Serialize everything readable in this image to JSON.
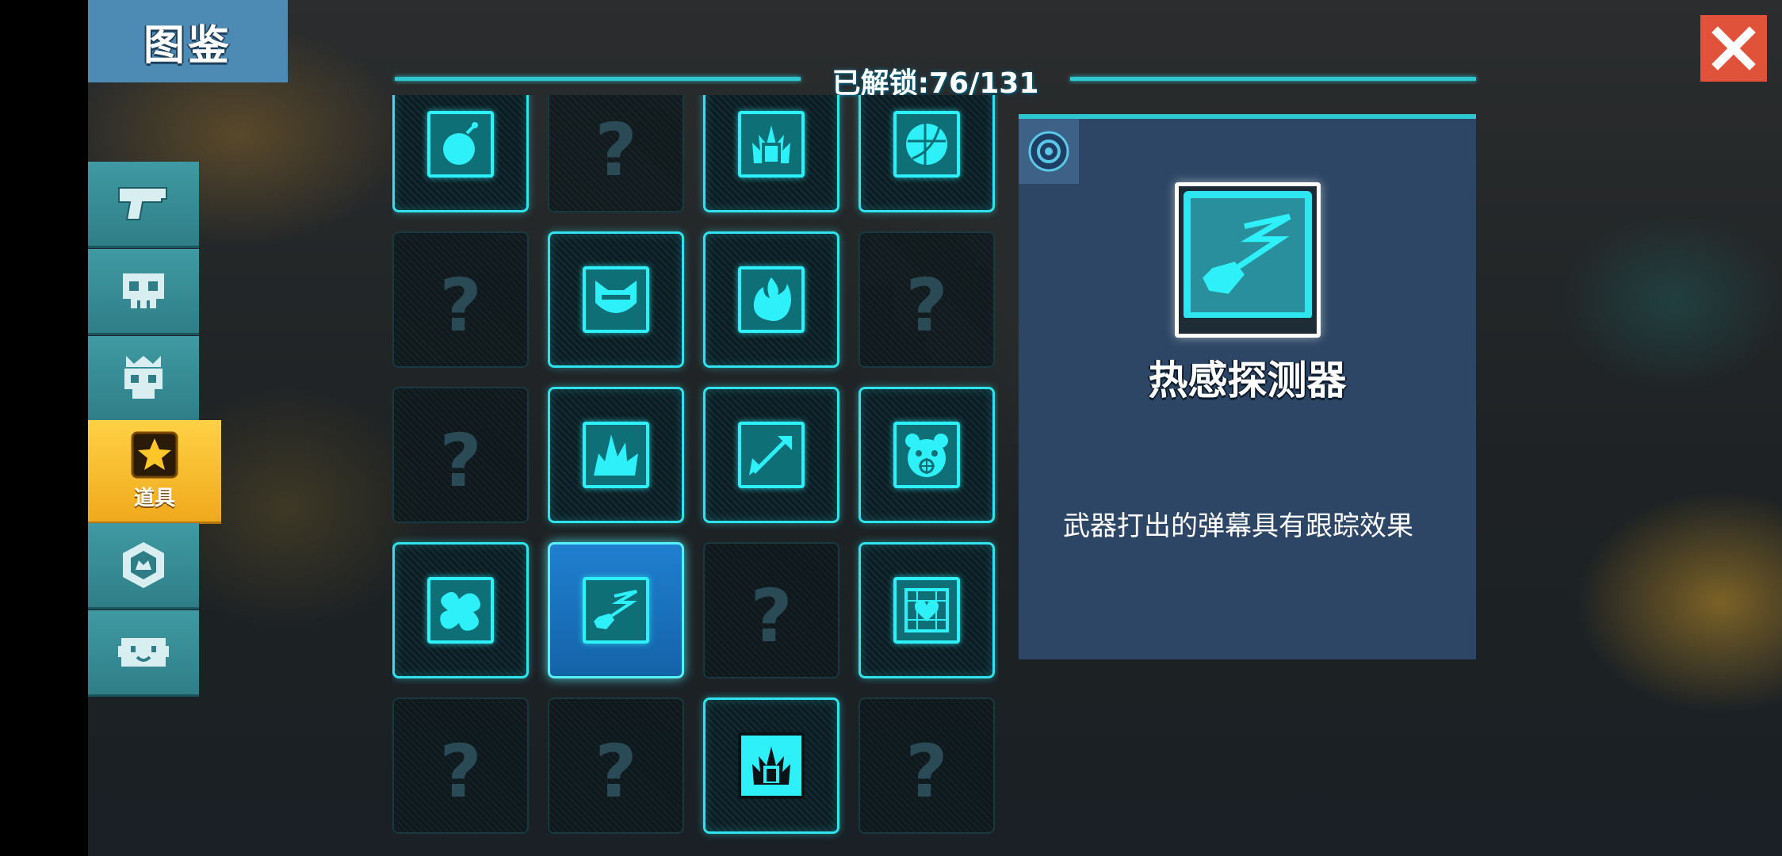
{
  "header": {
    "title": "图鉴",
    "unlock_text": "已解锁:76/131"
  },
  "close": {
    "icon": "close-icon"
  },
  "sidebar": {
    "tabs": [
      {
        "name": "weapons",
        "icon": "gun-icon",
        "label": ""
      },
      {
        "name": "monsters",
        "icon": "skull-icon",
        "label": ""
      },
      {
        "name": "bosses",
        "icon": "crowned-skull-icon",
        "label": ""
      },
      {
        "name": "items",
        "icon": "star-icon",
        "label": "道具",
        "active": true
      },
      {
        "name": "badges",
        "icon": "hexagon-badge-icon",
        "label": ""
      },
      {
        "name": "pets",
        "icon": "pet-face-icon",
        "label": ""
      }
    ]
  },
  "grid": {
    "cells": [
      {
        "state": "unlocked",
        "icon": "bomb-icon"
      },
      {
        "state": "locked",
        "text": "?"
      },
      {
        "state": "unlocked",
        "icon": "flame-jar-icon"
      },
      {
        "state": "unlocked",
        "icon": "orb-icon"
      },
      {
        "state": "locked",
        "text": "?"
      },
      {
        "state": "unlocked",
        "icon": "mask-icon"
      },
      {
        "state": "unlocked",
        "icon": "fire-icon"
      },
      {
        "state": "locked",
        "text": "?"
      },
      {
        "state": "locked",
        "text": "?"
      },
      {
        "state": "unlocked",
        "icon": "spike-burst-icon"
      },
      {
        "state": "unlocked",
        "icon": "diagonal-arrow-icon"
      },
      {
        "state": "unlocked",
        "icon": "bear-target-icon"
      },
      {
        "state": "unlocked",
        "icon": "splat-icon"
      },
      {
        "state": "selected",
        "icon": "heat-seeker-icon"
      },
      {
        "state": "locked",
        "text": "?"
      },
      {
        "state": "unlocked",
        "icon": "heart-frame-icon"
      },
      {
        "state": "locked",
        "text": "?"
      },
      {
        "state": "locked",
        "text": "?"
      },
      {
        "state": "unlocked-dark",
        "icon": "flame-jar-icon"
      },
      {
        "state": "locked",
        "text": "?"
      }
    ]
  },
  "detail": {
    "corner_icon": "target-icon",
    "item_icon": "heat-seeker-icon",
    "name": "热感探测器",
    "description": "武器打出的弹幕具有跟踪效果"
  },
  "colors": {
    "accent_cyan": "#2ec7cf",
    "active_tab": "#f0a91c",
    "close": "#e0523a"
  }
}
